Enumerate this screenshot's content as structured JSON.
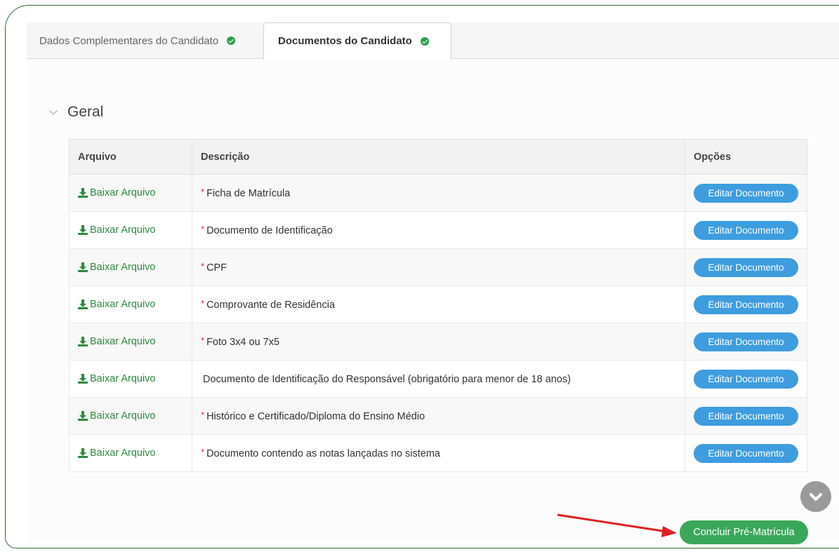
{
  "tabs": [
    {
      "label": "Dados Complementares do Candidato",
      "completed": true
    },
    {
      "label": "Documentos do Candidato",
      "completed": true,
      "active": true
    }
  ],
  "section": {
    "title": "Geral",
    "expanded": true
  },
  "table": {
    "headers": [
      "Arquivo",
      "Descrição",
      "Opções"
    ],
    "rows": [
      {
        "download": "Baixar Arquivo",
        "required": "*",
        "description": "Ficha de Matrícula",
        "action": "Editar Documento"
      },
      {
        "download": "Baixar Arquivo",
        "required": "*",
        "description": "Documento de Identificação",
        "action": "Editar Documento"
      },
      {
        "download": "Baixar Arquivo",
        "required": "*",
        "description": "CPF",
        "action": "Editar Documento"
      },
      {
        "download": "Baixar Arquivo",
        "required": "*",
        "description": "Comprovante de Residência",
        "action": "Editar Documento"
      },
      {
        "download": "Baixar Arquivo",
        "required": "*",
        "description": "Foto 3x4 ou 7x5",
        "action": "Editar Documento"
      },
      {
        "download": "Baixar Arquivo",
        "required": "",
        "description": "Documento de Identificação do Responsável (obrigatório para menor de 18 anos)",
        "action": "Editar Documento"
      },
      {
        "download": "Baixar Arquivo",
        "required": "*",
        "description": "Histórico e Certificado/Diploma do Ensino Médio",
        "action": "Editar Documento"
      },
      {
        "download": "Baixar Arquivo",
        "required": "*",
        "description": "Documento contendo as notas lançadas no sistema",
        "action": "Editar Documento"
      }
    ]
  },
  "submit_label": "Concluir Pré-Matrícula",
  "colors": {
    "download_green": "#2e8b3e",
    "edit_blue": "#3d9ddf",
    "submit_green": "#3aa85a",
    "required_red": "#e03030",
    "annotation_arrow": "#e02020"
  },
  "icons": {
    "download": "download-icon",
    "tab_check": "check-circle-icon",
    "section_toggle": "chevron-down-icon",
    "scroll": "chevron-down-icon"
  }
}
